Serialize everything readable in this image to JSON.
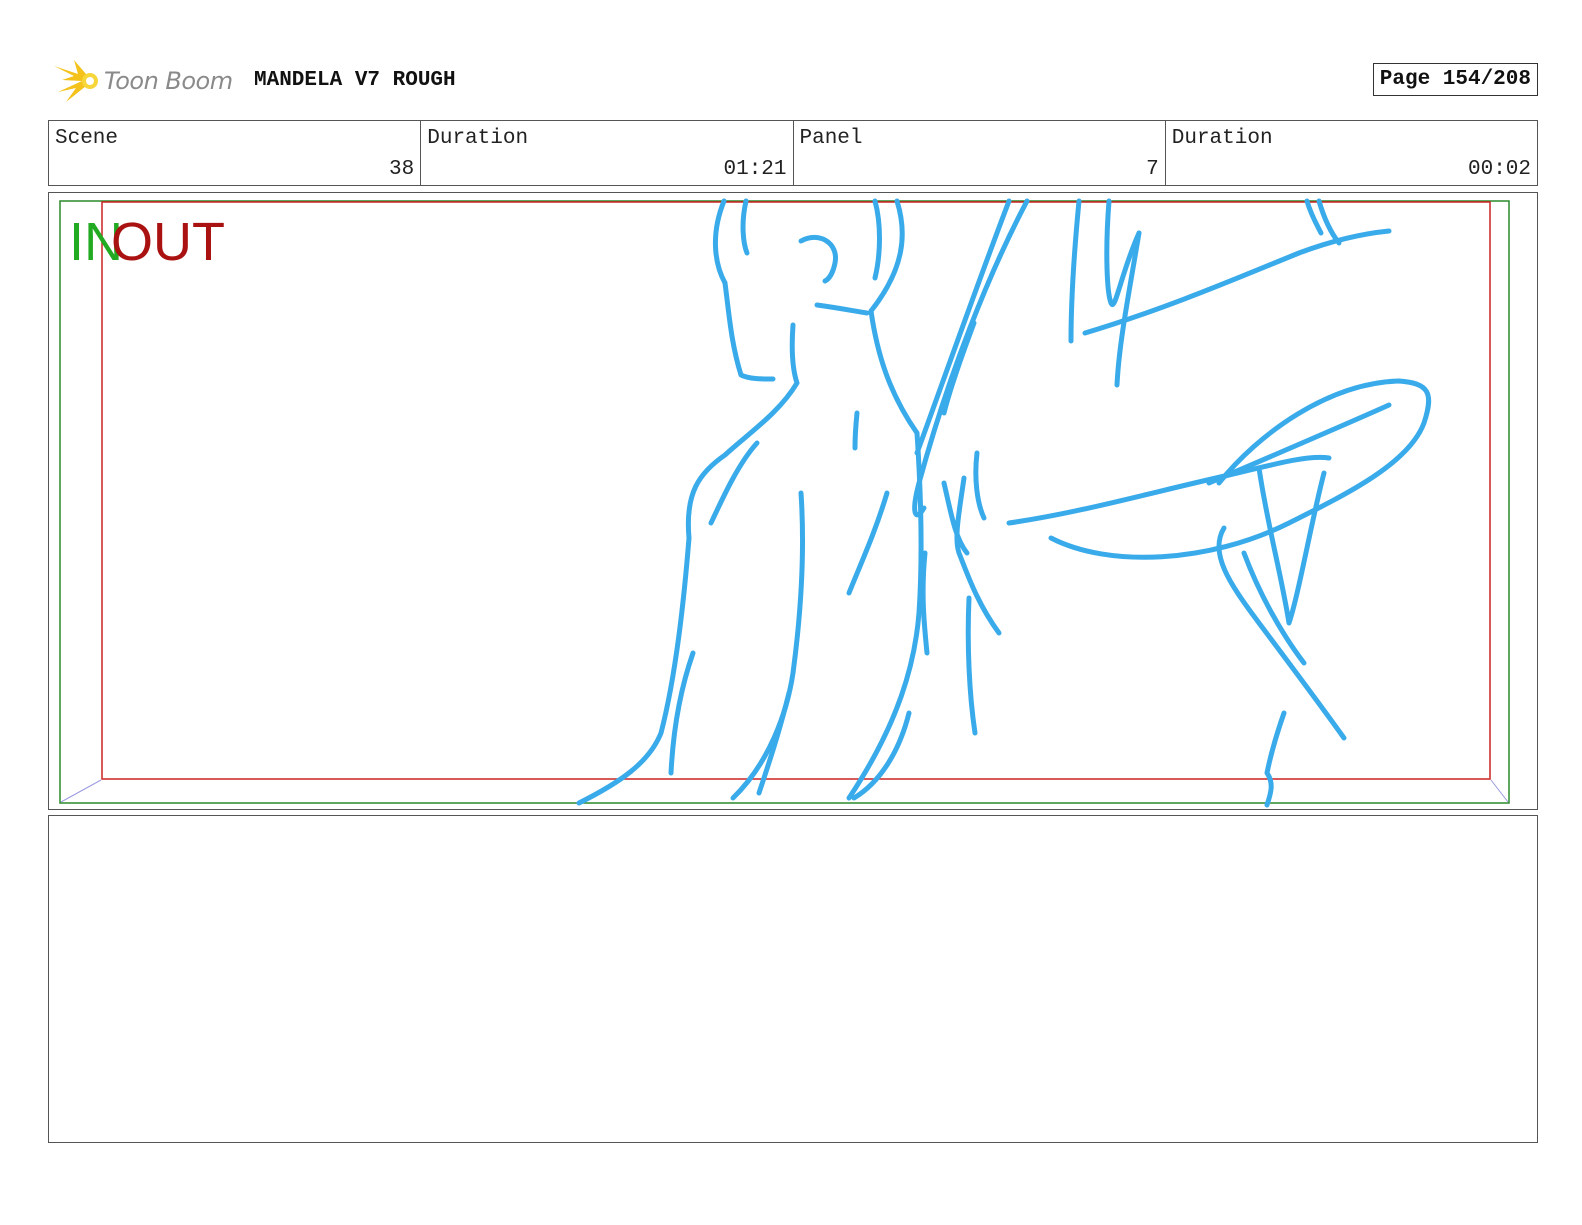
{
  "header": {
    "logo_text": "Toon Boom",
    "project_title": "MANDELA V7 ROUGH",
    "page_indicator": "Page 154/208"
  },
  "info": {
    "scene_label": "Scene",
    "scene_value": "38",
    "scene_duration_label": "Duration",
    "scene_duration_value": "01:21",
    "panel_label": "Panel",
    "panel_value": "7",
    "panel_duration_label": "Duration",
    "panel_duration_value": "00:02"
  },
  "frame": {
    "in_label": "IN",
    "out_label": "OUT"
  },
  "colors": {
    "sketch": "#3aabea",
    "in_frame": "#2a8a2a",
    "out_frame": "#cc2222",
    "logo": "#f4c21a"
  },
  "notes": {
    "text": ""
  }
}
